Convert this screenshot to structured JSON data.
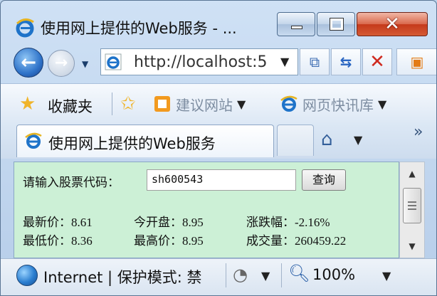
{
  "window": {
    "title": "使用网上提供的Web服务 - ..."
  },
  "address": {
    "url": "http://localhost:5",
    "dropdown_glyph": "▼"
  },
  "favorites": {
    "label": "收藏夹",
    "items": [
      {
        "label": "建议网站",
        "icon": "web-slice-icon"
      },
      {
        "label": "网页快讯库",
        "icon": "ie-icon"
      }
    ]
  },
  "tab": {
    "label": "使用网上提供的Web服务"
  },
  "query": {
    "label": "请输入股票代码：",
    "input_value": "sh600543",
    "button_label": "查询"
  },
  "stock": {
    "latest": "最新价：8.61",
    "open": "今开盘：8.95",
    "change": "涨跌幅：-2.16%",
    "low": "最低价：8.36",
    "high": "最高价：8.95",
    "volume": "成交量：260459.22"
  },
  "statusbar": {
    "zone": "Internet | 保护模式: 禁",
    "zoom": "100%"
  },
  "colors": {
    "content_bg": "#ccf0d6",
    "close_red": "#c5391b",
    "accent_blue": "#2f73c9"
  }
}
